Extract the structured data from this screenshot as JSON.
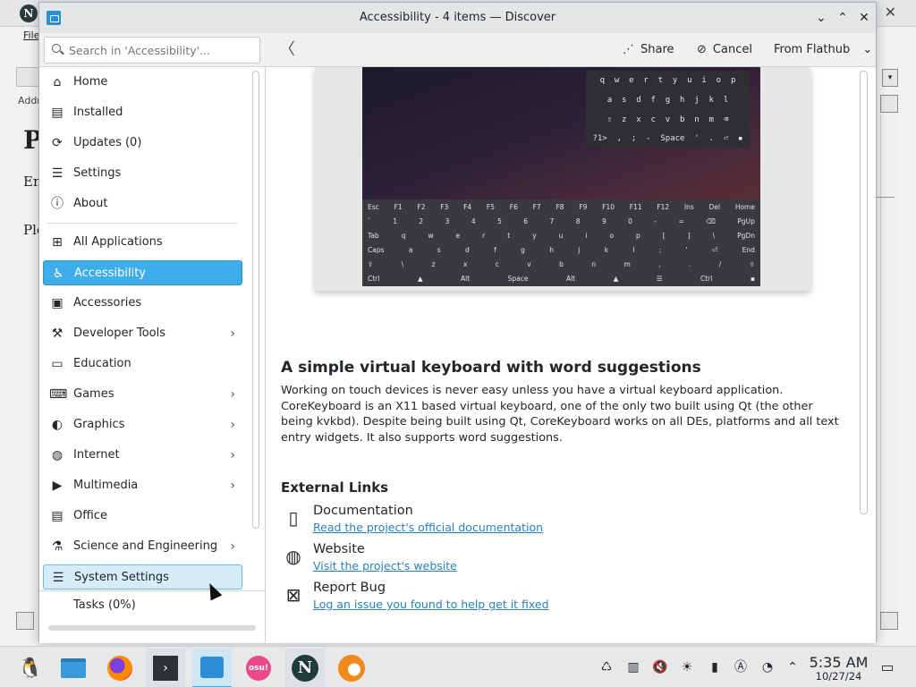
{
  "background_window": {
    "logo_letter": "N",
    "menu_label": "File",
    "addr_label": "Addr",
    "heading_fragment": "P",
    "line_en": "En",
    "line_pl": "Plo",
    "dropdown_arrow": "▾",
    "close_glyph": "✕"
  },
  "window": {
    "title": "Accessibility - 4 items — Discover",
    "buttons": {
      "minimize": "⌄",
      "maximize": "⌃",
      "close": "✕"
    }
  },
  "header": {
    "search_placeholder": "Search in 'Accessibility'...",
    "back_glyph": "〈",
    "share_label": "Share",
    "cancel_label": "Cancel",
    "source_label": "From Flathub",
    "share_icon": "share-icon",
    "cancel_icon": "cancel-icon",
    "dropdown_glyph": "⌄"
  },
  "sidebar": {
    "top_items": [
      {
        "label": "Home",
        "icon": "⌂"
      },
      {
        "label": "Installed",
        "icon": "▤"
      },
      {
        "label": "Updates (0)",
        "icon": "⟳"
      },
      {
        "label": "Settings",
        "icon": "☰"
      },
      {
        "label": "About",
        "icon": "ⓘ"
      }
    ],
    "categories": [
      {
        "label": "All Applications",
        "icon": "⊞",
        "chevron": ""
      },
      {
        "label": "Accessibility",
        "icon": "♿",
        "chevron": ""
      },
      {
        "label": "Accessories",
        "icon": "▣",
        "chevron": ""
      },
      {
        "label": "Developer Tools",
        "icon": "⚒",
        "chevron": "›"
      },
      {
        "label": "Education",
        "icon": "▭",
        "chevron": ""
      },
      {
        "label": "Games",
        "icon": "⌨",
        "chevron": "›"
      },
      {
        "label": "Graphics",
        "icon": "◐",
        "chevron": "›"
      },
      {
        "label": "Internet",
        "icon": "◍",
        "chevron": "›"
      },
      {
        "label": "Multimedia",
        "icon": "▶",
        "chevron": "›"
      },
      {
        "label": "Office",
        "icon": "▤",
        "chevron": ""
      },
      {
        "label": "Science and Engineering",
        "icon": "⚗",
        "chevron": "›"
      },
      {
        "label": "System Settings",
        "icon": "☰",
        "chevron": ""
      }
    ],
    "tasks_label": "Tasks (0%)"
  },
  "screenshot": {
    "float_rows": [
      "q  w  e  r  t  y  u  i  o  p",
      " a  s  d  f  g  h  j  k  l ",
      "⇧  z  x  c  v  b  n  m  ⌫",
      "?1>  ,  ;  -  Space  '  .  ⏎  ▪"
    ],
    "full_rows": [
      [
        "Esc",
        "F1",
        "F2",
        "F3",
        "F4",
        "F5",
        "F6",
        "F7",
        "F8",
        "F9",
        "F10",
        "F11",
        "F12",
        "Ins",
        "Del",
        "Home"
      ],
      [
        "`",
        "1",
        "2",
        "3",
        "4",
        "5",
        "6",
        "7",
        "8",
        "9",
        "0",
        "-",
        "=",
        "⌫",
        "PgUp"
      ],
      [
        "Tab",
        "q",
        "w",
        "e",
        "r",
        "t",
        "y",
        "u",
        "i",
        "o",
        "p",
        "[",
        "]",
        "\\",
        "PgDn"
      ],
      [
        "Caps",
        "a",
        "s",
        "d",
        "f",
        "g",
        "h",
        "j",
        "k",
        "l",
        ";",
        "'",
        "⏎",
        "End"
      ],
      [
        "⇧",
        "\\",
        "z",
        "x",
        "c",
        "v",
        "b",
        "n",
        "m",
        ",",
        ".",
        "/",
        "⇧"
      ],
      [
        "Ctrl",
        "▲",
        "Alt",
        "Space",
        "Alt",
        "▲",
        "☰",
        "Ctrl",
        "▪"
      ]
    ]
  },
  "description": {
    "title": "A simple virtual keyboard with word suggestions",
    "body": "Working on touch devices is never easy unless you have a virtual keyboard application. CoreKeyboard is an X11 based virtual keyboard, one of the only two built using Qt (the other being kvkbd). Despite being built using Qt, CoreKeyboard works on all DEs, platforms and all text entry widgets. It also supports word suggestions."
  },
  "external_links": {
    "title": "External Links",
    "items": [
      {
        "name": "Documentation",
        "link": "Read the project's official documentation",
        "icon": "▯"
      },
      {
        "name": "Website",
        "link": "Visit the project's website",
        "icon": "◍"
      },
      {
        "name": "Report Bug",
        "link": "Log an issue you found to help get it fixed",
        "icon": "⊠"
      }
    ]
  },
  "taskbar": {
    "apps": [
      {
        "name": "tux-icon",
        "glyph": "🐧"
      },
      {
        "name": "file-manager-icon",
        "glyph": "▬"
      },
      {
        "name": "firefox-icon",
        "glyph": "◉"
      },
      {
        "name": "terminal-icon",
        "glyph": "›"
      },
      {
        "name": "discover-icon",
        "glyph": "▣"
      },
      {
        "name": "osu-icon",
        "glyph": "osu!"
      },
      {
        "name": "netscape-icon",
        "glyph": "N"
      },
      {
        "name": "orange-app-icon",
        "glyph": "◔"
      }
    ],
    "tray": [
      "♺",
      "▥",
      "🔇",
      "☀",
      "▮",
      "Ⓐ",
      "◔",
      "⌃"
    ],
    "time": "5:35 AM",
    "date": "10/27/24",
    "show_desktop_glyph": "▭"
  },
  "colors": {
    "accent": "#3daee9",
    "link": "#2980b9",
    "window_bg": "#ffffff",
    "chrome_bg": "#eff0f1"
  }
}
